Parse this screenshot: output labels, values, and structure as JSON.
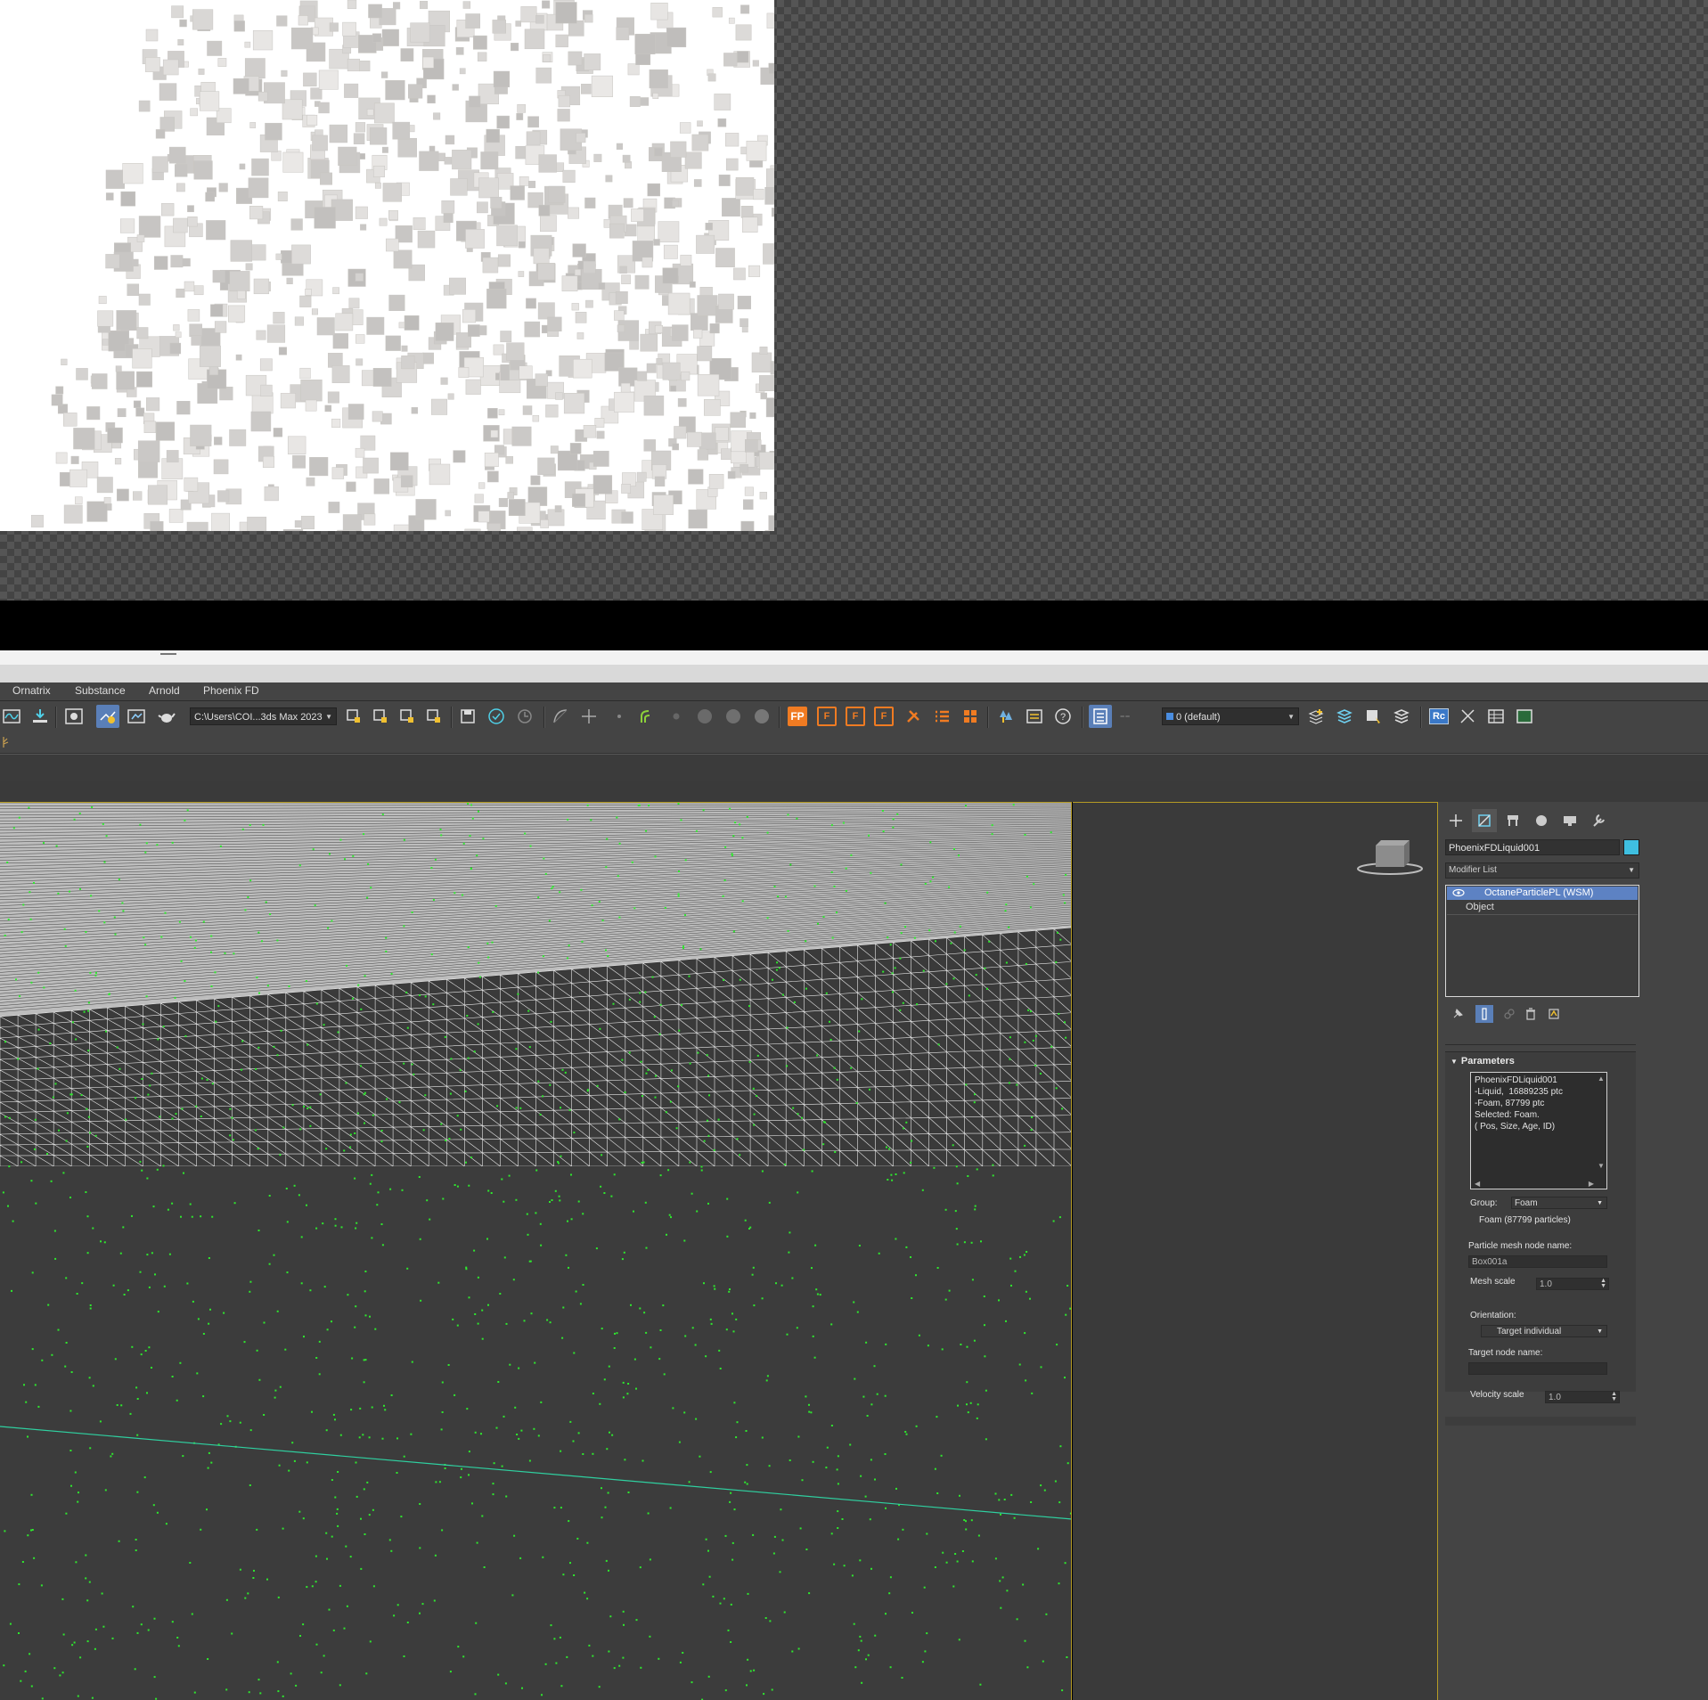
{
  "menu": {
    "items": [
      "Ornatrix",
      "Substance",
      "Arnold",
      "Phoenix FD"
    ]
  },
  "toolbar": {
    "path_dropdown": "C:\\Users\\COI...3ds Max 2023",
    "layer_dropdown": "0 (default)",
    "fp_label": "FP",
    "f1_label": "F",
    "f2_label": "F",
    "f3_label": "F",
    "rc_label": "Rc"
  },
  "command_panel": {
    "object_name": "PhoenixFDLiquid001",
    "object_color": "#3fbfe0",
    "modifier_list_label": "Modifier List",
    "stack": [
      {
        "label": "OctaneParticlePL (WSM)",
        "selected": true
      },
      {
        "label": "Object",
        "selected": false
      }
    ],
    "parameters": {
      "header": "Parameters",
      "info_lines": [
        "PhoenixFDLiquid001",
        "-Liquid,  16889235 ptc",
        "-Foam, 87799 ptc",
        "Selected: Foam.",
        "( Pos, Size, Age, ID)"
      ],
      "group_label": "Group:",
      "group_value": "Foam",
      "group_count": "Foam (87799 particles)",
      "mesh_node_label": "Particle mesh node name:",
      "mesh_node_value": "Box001a",
      "mesh_scale_label": "Mesh scale",
      "mesh_scale_value": "1.0",
      "orientation_label": "Orientation:",
      "orientation_value": "Target individual",
      "target_node_label": "Target node name:",
      "target_node_value": "",
      "velocity_scale_label": "Velocity scale",
      "velocity_scale_value": "1.0"
    }
  },
  "colors": {
    "viewport_border": "#b59b25",
    "selection_blue": "#5d82c3",
    "accent_orange": "#f07b22",
    "particle_green": "#2ee82e"
  }
}
